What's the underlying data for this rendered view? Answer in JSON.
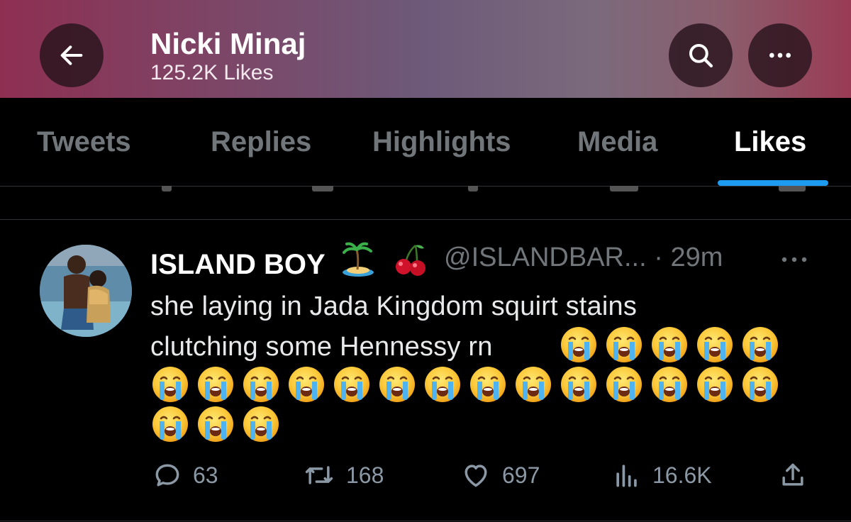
{
  "header": {
    "title": "Nicki Minaj",
    "subtitle": "125.2K Likes",
    "back_icon": "arrow-left-icon",
    "search_icon": "search-icon",
    "more_icon": "more-horizontal-icon"
  },
  "tabs": [
    {
      "label": "Tweets",
      "active": false
    },
    {
      "label": "Replies",
      "active": false
    },
    {
      "label": "Highlights",
      "active": false
    },
    {
      "label": "Media",
      "active": false
    },
    {
      "label": "Likes",
      "active": true
    }
  ],
  "tweet": {
    "display_name": "ISLAND BOY",
    "name_emojis": [
      "desert-island-emoji",
      "cherries-emoji"
    ],
    "handle": "@ISLANDBAR...",
    "separator": "·",
    "time": "29m",
    "text_line1": "she laying in Jada Kingdom squirt stains",
    "text_line2": "clutching some Hennessy rn",
    "sob_emoji_count": 22,
    "actions": {
      "replies": "63",
      "retweets": "168",
      "likes": "697",
      "views": "16.6K"
    }
  },
  "colors": {
    "accent": "#1d9bf0",
    "muted": "#71767b",
    "background": "#000000"
  }
}
